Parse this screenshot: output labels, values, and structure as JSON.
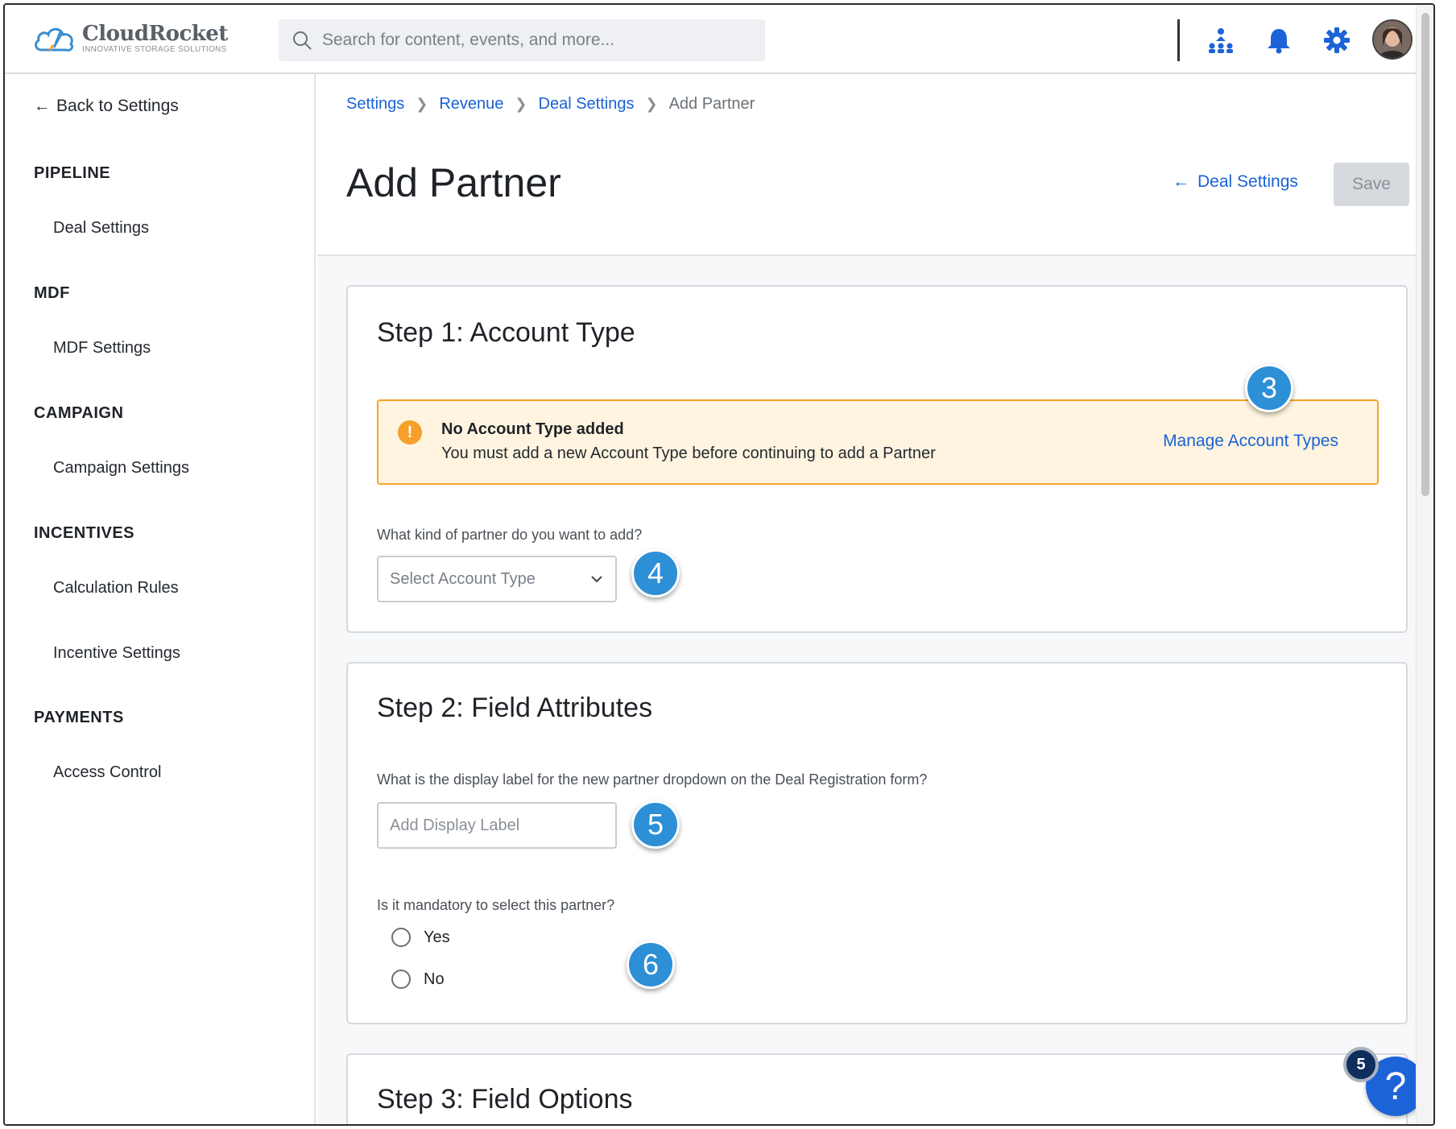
{
  "header": {
    "logo_name": "CloudRocket",
    "logo_tagline": "INNOVATIVE STORAGE SOLUTIONS",
    "search_placeholder": "Search for content, events, and more...",
    "icons": [
      "org-chart-icon",
      "bell-icon",
      "gear-icon"
    ]
  },
  "sidebar": {
    "back_label": "Back to Settings",
    "sections": [
      {
        "title": "PIPELINE",
        "items": [
          "Deal Settings"
        ]
      },
      {
        "title": "MDF",
        "items": [
          "MDF Settings"
        ]
      },
      {
        "title": "CAMPAIGN",
        "items": [
          "Campaign Settings"
        ]
      },
      {
        "title": "INCENTIVES",
        "items": [
          "Calculation Rules",
          "Incentive Settings"
        ]
      },
      {
        "title": "PAYMENTS",
        "items": [
          "Access Control"
        ]
      }
    ]
  },
  "breadcrumb": {
    "items": [
      "Settings",
      "Revenue",
      "Deal Settings"
    ],
    "current": "Add Partner"
  },
  "page": {
    "title": "Add Partner",
    "back_label": "Deal Settings",
    "save_label": "Save"
  },
  "step1": {
    "title": "Step 1: Account Type",
    "alert_title": "No Account Type added",
    "alert_body": "You must add a new Account Type before continuing to add a Partner",
    "alert_link": "Manage Account Types",
    "question": "What kind of partner do you want to add?",
    "select_placeholder": "Select Account Type"
  },
  "step2": {
    "title": "Step 2: Field Attributes",
    "label_question": "What is the display label for the new partner dropdown on the Deal Registration form?",
    "label_placeholder": "Add Display Label",
    "mandatory_question": "Is it mandatory to select this partner?",
    "options": [
      "Yes",
      "No"
    ]
  },
  "step3": {
    "title": "Step 3: Field Options"
  },
  "callouts": [
    "3",
    "4",
    "5",
    "6"
  ],
  "help": {
    "symbol": "?",
    "badge_count": "5"
  },
  "colors": {
    "link": "#1a62d4",
    "warning_bg": "#fff4e0",
    "warning_border": "#f5a623",
    "callout": "#2d8fd6",
    "help_button": "#1d63d8"
  }
}
